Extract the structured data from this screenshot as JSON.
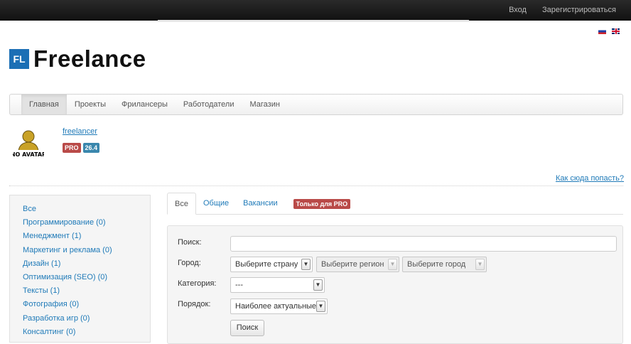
{
  "topbar": {
    "login": "Вход",
    "register": "Зарегистрироваться"
  },
  "language": {
    "ru_icon": "flag-ru-icon",
    "en_icon": "flag-en-icon"
  },
  "logo": {
    "mark": "FL",
    "text": "Freelance"
  },
  "nav": {
    "items": [
      "Главная",
      "Проекты",
      "Фрилансеры",
      "Работодатели",
      "Магазин"
    ],
    "active": 0
  },
  "user": {
    "avatar_label": "NO AVATAR",
    "name": "freelancer",
    "pro_badge": "PRO",
    "rating": "26.4"
  },
  "howto_link": "Как сюда попасть?",
  "categories": [
    "Все",
    "Программирование (0)",
    "Менеджмент (1)",
    "Маркетинг и реклама (0)",
    "Дизайн (1)",
    "Оптимизация (SEO) (0)",
    "Тексты (1)",
    "Фотография (0)",
    "Разработка игр (0)",
    "Консалтинг (0)"
  ],
  "tabs": {
    "items": [
      "Все",
      "Общие",
      "Вакансии"
    ],
    "active": 0,
    "pro_only": "Только для PRO"
  },
  "filter": {
    "search_label": "Поиск:",
    "search_value": "",
    "city_label": "Город:",
    "country": "Выберите страну",
    "region": "Выберите регион",
    "city": "Выберите город",
    "category_label": "Категория:",
    "category": "---",
    "order_label": "Порядок:",
    "order": "Наиболее актуальные",
    "submit": "Поиск"
  },
  "colors": {
    "link": "#1f7ab8",
    "pro": "#b94a48",
    "rating": "#3a87ad",
    "logo": "#1b6fb5",
    "topbar": "#111111"
  }
}
